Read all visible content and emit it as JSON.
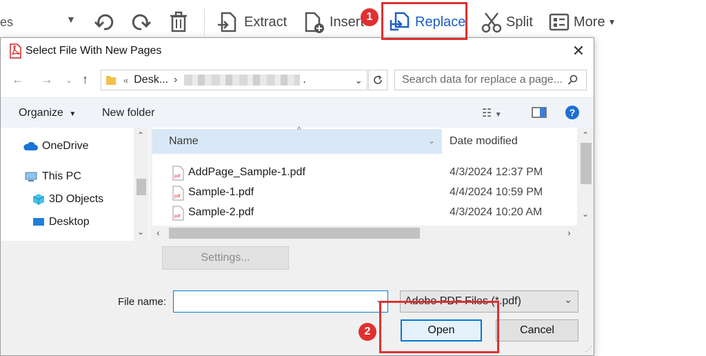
{
  "toolbar": {
    "partial_dropdown_text": "es",
    "extract_label": "Extract",
    "insert_label": "Insert",
    "replace_label": "Replace",
    "split_label": "Split",
    "more_label": "More",
    "step1": "1",
    "step2": "2"
  },
  "dialog": {
    "title": "Select File With New Pages",
    "breadcrumb_chevron": "«",
    "breadcrumb_folder": "Desk...",
    "breadcrumb_sep": "›",
    "breadcrumb_tail": ".",
    "search_placeholder": "Search data for replace a page...",
    "organize_label": "Organize",
    "new_folder_label": "New folder",
    "nav_items": [
      {
        "label": "OneDrive"
      },
      {
        "label": "This PC"
      },
      {
        "label": "3D Objects"
      },
      {
        "label": "Desktop"
      }
    ],
    "columns": {
      "name": "Name",
      "date": "Date modified"
    },
    "files": [
      {
        "name": "AddPage_Sample-1.pdf",
        "date": "4/3/2024 12:37 PM"
      },
      {
        "name": "Sample-1.pdf",
        "date": "4/4/2024 10:59 PM"
      },
      {
        "name": "Sample-2.pdf",
        "date": "4/3/2024 10:20 AM"
      }
    ],
    "settings_label": "Settings...",
    "filename_label": "File name:",
    "filename_value": "",
    "filter_value": "Adobe PDF Files (*.pdf)",
    "open_label": "Open",
    "cancel_label": "Cancel"
  },
  "colors": {
    "highlight": "#e03030",
    "accent": "#0078d7",
    "column_header_bg": "#d9e8f6"
  }
}
